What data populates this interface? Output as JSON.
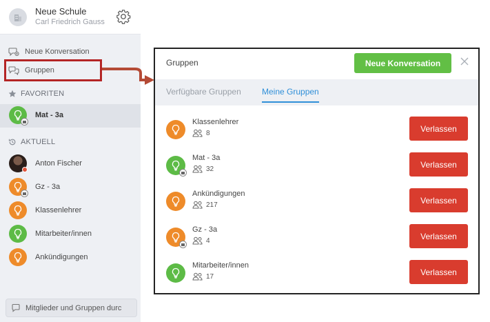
{
  "sidebar": {
    "school_name": "Neue Schule",
    "user_name": "Carl Friedrich Gauss",
    "new_conversation": "Neue Konversation",
    "groups": "Gruppen",
    "favorites_title": "FAVORITEN",
    "favorites": [
      {
        "name": "Mat - 3a",
        "color": "#5dbb46",
        "locked": true
      }
    ],
    "recent_title": "AKTUELL",
    "recent": [
      {
        "name": "Anton Fischer",
        "type": "photo"
      },
      {
        "name": "Gz - 3a",
        "color": "#ee8b2a",
        "locked": true
      },
      {
        "name": "Klassenlehrer",
        "color": "#ee8b2a"
      },
      {
        "name": "Mitarbeiter/innen",
        "color": "#5dbb46"
      },
      {
        "name": "Ankündigungen",
        "color": "#ee8b2a"
      }
    ],
    "search_placeholder": "Mitglieder und Gruppen durc"
  },
  "modal": {
    "title": "Gruppen",
    "new_button": "Neue Konversation",
    "tabs": [
      {
        "label": "Verfügbare Gruppen",
        "active": false
      },
      {
        "label": "Meine Gruppen",
        "active": true
      }
    ],
    "leave_label": "Verlassen",
    "groups": [
      {
        "name": "Klassenlehrer",
        "members": "8",
        "color": "#ee8b2a",
        "locked": false
      },
      {
        "name": "Mat - 3a",
        "members": "32",
        "color": "#5dbb46",
        "locked": true
      },
      {
        "name": "Ankündigungen",
        "members": "217",
        "color": "#ee8b2a",
        "locked": false
      },
      {
        "name": "Gz - 3a",
        "members": "4",
        "color": "#ee8b2a",
        "locked": true
      },
      {
        "name": "Mitarbeiter/innen",
        "members": "17",
        "color": "#5dbb46",
        "locked": false
      }
    ]
  },
  "colors": {
    "accent_green": "#62bf45",
    "leave_red": "#d93c2e",
    "tab_blue": "#2f8fd8",
    "highlight_red": "#b42525"
  }
}
